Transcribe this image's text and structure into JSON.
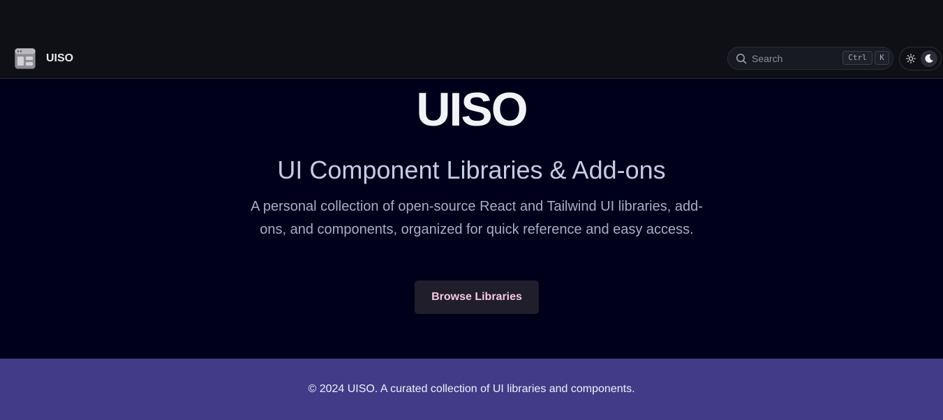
{
  "header": {
    "logo_icon": "layout-window-icon",
    "brand": "UISO",
    "search": {
      "label": "Search",
      "icon": "search-icon",
      "shortcut_ctrl": "Ctrl",
      "shortcut_key": "K"
    },
    "theme_toggle": {
      "options": [
        "light",
        "dark"
      ],
      "selected": "dark",
      "light_icon": "sun-icon",
      "dark_icon": "moon-icon"
    }
  },
  "hero": {
    "title": "UISO",
    "subtitle": "UI Component Libraries & Add-ons",
    "description": "A personal collection of open-source React and Tailwind UI libraries, add-ons, and components, organized for quick reference and easy access.",
    "cta_label": "Browse Libraries"
  },
  "footer": {
    "text": "© 2024 UISO. A curated collection of UI libraries and components."
  },
  "colors": {
    "page_background": "#00001a",
    "header_background": "#0f1015",
    "footer_background": "#413b88",
    "cta_background": "#211e2c",
    "cta_text": "#f5c8dd"
  }
}
